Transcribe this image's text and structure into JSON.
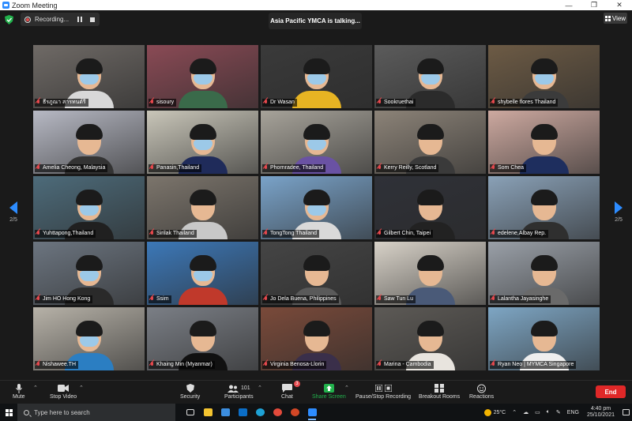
{
  "window": {
    "title": "Zoom Meeting",
    "minimize": "—",
    "maximize": "❐",
    "close": "✕"
  },
  "header": {
    "recording_label": "Recording...",
    "talking_indicator": "Asia Pacific YMCA is talking...",
    "view_label": "View"
  },
  "pager": {
    "left": "2/5",
    "right": "2/5"
  },
  "participants": [
    {
      "name": "ธีรภูณา สารทนต์รี"
    },
    {
      "name": "sisoury"
    },
    {
      "name": "Dr Wasan"
    },
    {
      "name": "Sookruethai"
    },
    {
      "name": "shybelle flores Thailand"
    },
    {
      "name": "Amelia Cheong, Malaysia"
    },
    {
      "name": "Panasin,Thailand"
    },
    {
      "name": "Phornradee, Thailand"
    },
    {
      "name": "Kerry Reilly, Scotland"
    },
    {
      "name": "Som Chea"
    },
    {
      "name": "Yuhttapong,Thailand"
    },
    {
      "name": "Sirilak Thailand"
    },
    {
      "name": "TongTong Thailand"
    },
    {
      "name": "Gilbert Chin, Taipei"
    },
    {
      "name": "edelene,Albay Rep."
    },
    {
      "name": "Jim HO Hong Kong"
    },
    {
      "name": "Ssim"
    },
    {
      "name": "Jo Dela Buena, Philippines"
    },
    {
      "name": "Saw Tun Lu"
    },
    {
      "name": "Lalantha Jayasinghe"
    },
    {
      "name": "Nishawee.TH"
    },
    {
      "name": "Khaing Min (Myanmar)"
    },
    {
      "name": "Virginia Benosa-Llorin"
    },
    {
      "name": "Marina - Cambodia"
    },
    {
      "name": "Ryan Neo | MYMCA Singapore"
    }
  ],
  "toolbar": {
    "mute": "Mute",
    "stop_video": "Stop Video",
    "security": "Security",
    "participants": "Participants",
    "participants_count": "101",
    "chat": "Chat",
    "chat_badge": "3",
    "share_screen": "Share Screen",
    "record": "Pause/Stop Recording",
    "breakout": "Breakout Rooms",
    "reactions": "Reactions",
    "end": "End"
  },
  "taskbar": {
    "search_placeholder": "Type here to search",
    "weather": "25°C",
    "lang": "ENG",
    "time": "4:40 pm",
    "date": "25/10/2021"
  },
  "colors": {
    "accent": "#2d8cff",
    "end": "#e02828",
    "share": "#22b14c",
    "speaker": "#f5d90a"
  }
}
